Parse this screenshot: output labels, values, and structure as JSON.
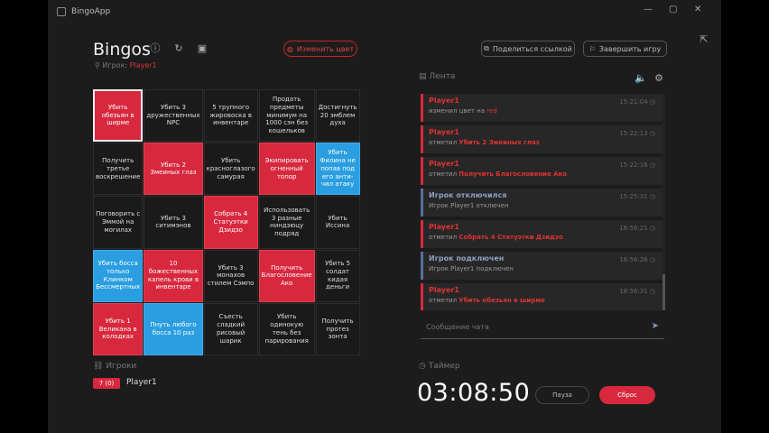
{
  "window": {
    "title": "BingoApp",
    "controls": [
      "—",
      "▢",
      "✕"
    ]
  },
  "header": {
    "title": "Bingos",
    "owner_label": "Игрок:",
    "owner_name": "Player1",
    "change_color": "Изменить цвет",
    "share": "Поделиться ссылкой",
    "finish": "Завершить игру"
  },
  "board": [
    {
      "text": "Убить обезьян в ширме",
      "state": "red",
      "selected": true
    },
    {
      "text": "Убить 3 дружественных NPC",
      "state": "none"
    },
    {
      "text": "5 трупного жировоска в инвентаре",
      "state": "none"
    },
    {
      "text": "Продать предметы минимум на 1000 сэн без кошельков",
      "state": "none"
    },
    {
      "text": "Достигнуть 20 эмблем духа",
      "state": "none"
    },
    {
      "text": "Получить третье воскрешение",
      "state": "none"
    },
    {
      "text": "Убить 2 Змеиных глаз",
      "state": "red"
    },
    {
      "text": "Убить красноглазого самурая",
      "state": "none"
    },
    {
      "text": "Экипировать огненный топор",
      "state": "red"
    },
    {
      "text": "Убить Филина не попав под его анти-чил атаку",
      "state": "blue"
    },
    {
      "text": "Поговорить с Эммой на могилах",
      "state": "none"
    },
    {
      "text": "Убить 3 ситимэнов",
      "state": "none"
    },
    {
      "text": "Собрать 4 Статуэтки Дзидзо",
      "state": "red"
    },
    {
      "text": "Использовать 3 разные ниндзюцу подряд",
      "state": "none"
    },
    {
      "text": "Убить Иссина",
      "state": "none"
    },
    {
      "text": "Убить босса только Клинком Бессмертных",
      "state": "blue"
    },
    {
      "text": "10 божественных капель крови в инвентаре",
      "state": "red"
    },
    {
      "text": "Убить 3 монахов стилем Сэмпо",
      "state": "none"
    },
    {
      "text": "Получить Благословение Ако",
      "state": "red"
    },
    {
      "text": "Убить 5 солдат кидая деньги",
      "state": "none"
    },
    {
      "text": "Убить 1 Великана в колодках",
      "state": "red"
    },
    {
      "text": "Пнуть любого босса 10 раз",
      "state": "blue"
    },
    {
      "text": "Съесть сладкий рисовый шарик",
      "state": "none"
    },
    {
      "text": "Убить одинокую тень без парирования",
      "state": "none"
    },
    {
      "text": "Получить протез зонта",
      "state": "none"
    }
  ],
  "players_section": {
    "title": "Игроки",
    "players": [
      {
        "badge": "7 (0)",
        "name": "Player1"
      }
    ]
  },
  "feed": {
    "title": "Лента",
    "events": [
      {
        "kind": "player",
        "title": "Player1",
        "time": "15:21:04",
        "desc": "изменил цвет на",
        "highlight": "red"
      },
      {
        "kind": "player",
        "title": "Player1",
        "time": "15:22:13",
        "desc": "отметил",
        "highlight": "Убить 2 Змеиных глаз"
      },
      {
        "kind": "player",
        "title": "Player1",
        "time": "15:22:16",
        "desc": "отметил",
        "highlight": "Получить Благословение Ако"
      },
      {
        "kind": "system",
        "title": "Игрок отключился",
        "time": "15:25:31",
        "desc": "Игрок Player1 отключен",
        "highlight": ""
      },
      {
        "kind": "player",
        "title": "Player1",
        "time": "18:56:21",
        "desc": "отметил",
        "highlight": "Собрать 4 Статуэтки Дзидзо"
      },
      {
        "kind": "system",
        "title": "Игрок подключен",
        "time": "18:56:26",
        "desc": "Игрок Player1 подключен",
        "highlight": ""
      },
      {
        "kind": "player",
        "title": "Player1",
        "time": "18:56:31",
        "desc": "отметил",
        "highlight": "Убить обезьян в ширме"
      }
    ],
    "chat_placeholder": "Сообщение чата"
  },
  "timer": {
    "title": "Таймер",
    "value": "03:08:50",
    "pause": "Пауза",
    "reset": "Сброс"
  },
  "colors": {
    "red": "#d8283e",
    "blue": "#2a9ee0",
    "bg": "#1c1c1c",
    "cell": "#1a1a1a"
  }
}
